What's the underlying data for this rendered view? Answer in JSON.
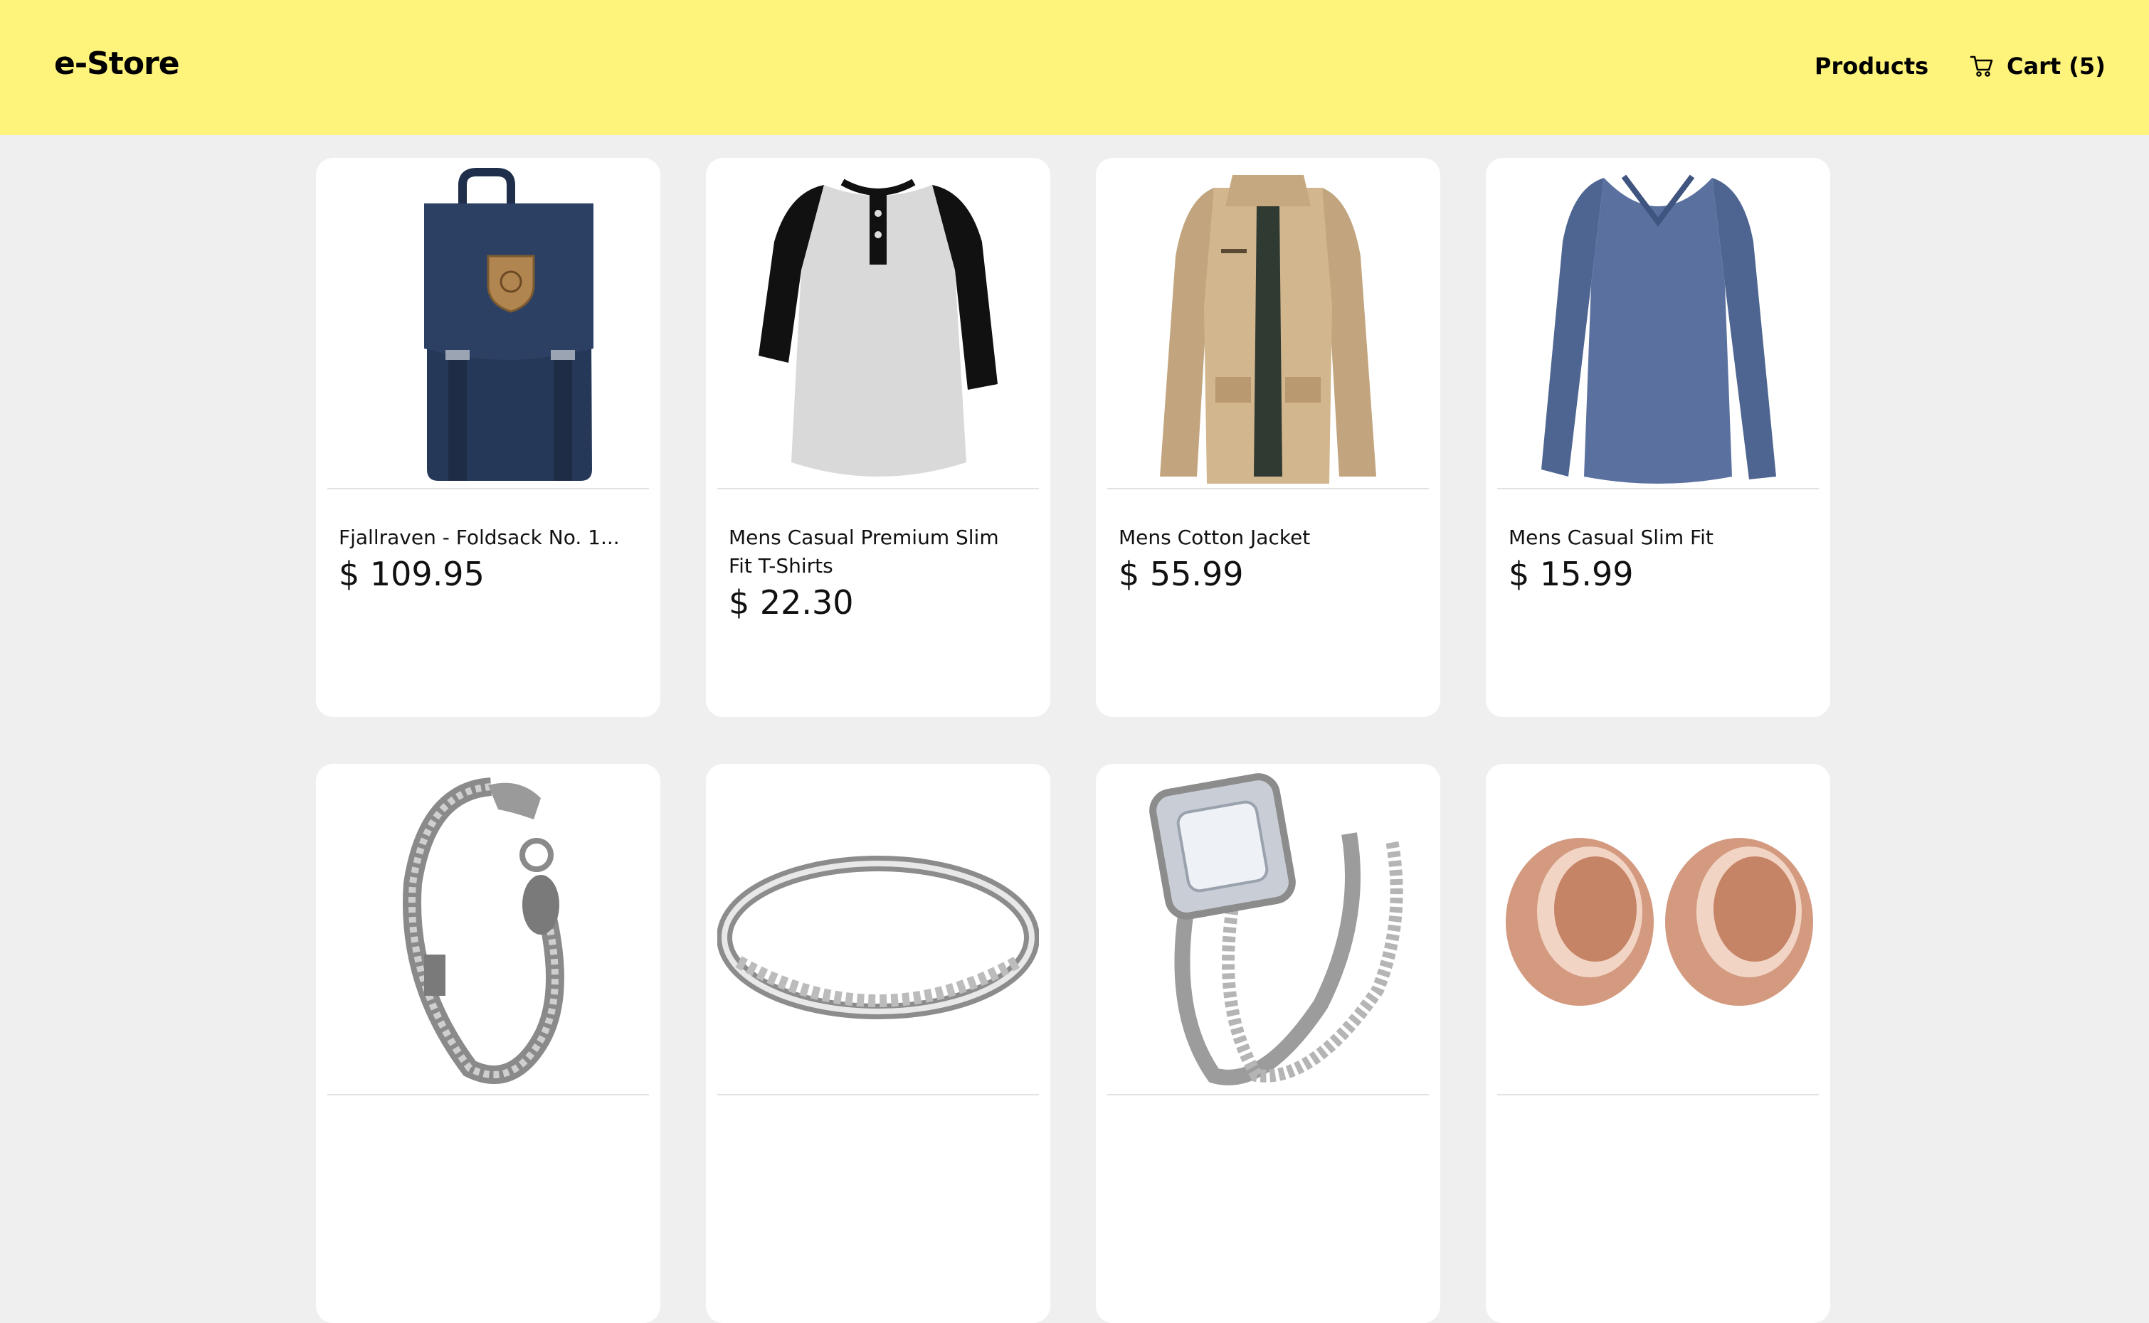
{
  "header": {
    "brand": "e-Store",
    "nav_products": "Products",
    "nav_cart": "Cart (5)",
    "background_color": "#fef47b"
  },
  "products": [
    {
      "title": "Fjallraven - Foldsack No. 1...",
      "price": "$ 109.95",
      "image": "navy-backpack"
    },
    {
      "title": "Mens Casual Premium Slim Fit T-Shirts",
      "price": "$ 22.30",
      "image": "raglan-henley-tshirt"
    },
    {
      "title": "Mens Cotton Jacket",
      "price": "$ 55.99",
      "image": "khaki-jacket"
    },
    {
      "title": "Mens Casual Slim Fit",
      "price": "$ 15.99",
      "image": "blue-longsleeve-shirt"
    },
    {
      "title": "",
      "price": "",
      "image": "silver-dragon-bracelet"
    },
    {
      "title": "",
      "price": "",
      "image": "silver-band-ring"
    },
    {
      "title": "",
      "price": "",
      "image": "diamond-ring-set"
    },
    {
      "title": "",
      "price": "",
      "image": "rose-gold-tunnel-plugs"
    }
  ]
}
